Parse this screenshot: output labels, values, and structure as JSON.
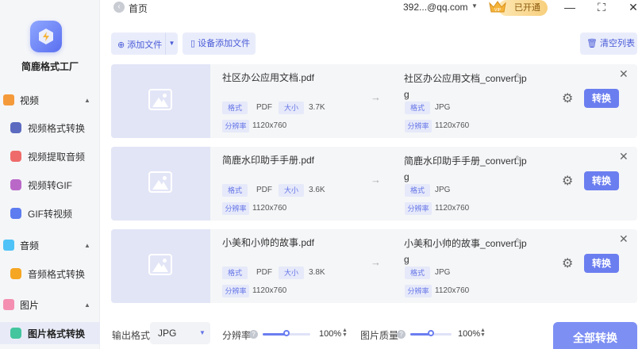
{
  "app": {
    "name": "简鹿格式工厂"
  },
  "sidebar": {
    "categories": [
      {
        "label": "视频",
        "color": "#f59a3b"
      },
      {
        "label": "音频",
        "color": "#4fc3f7"
      },
      {
        "label": "图片",
        "color": "#f48fb1"
      }
    ],
    "items": [
      {
        "label": "视频格式转换",
        "color": "#5c6bc0"
      },
      {
        "label": "视频提取音频",
        "color": "#ef6b6b"
      },
      {
        "label": "视频转GIF",
        "color": "#ba68c8"
      },
      {
        "label": "GIF转视频",
        "color": "#5c7cf0"
      },
      {
        "label": "音频格式转换",
        "color": "#f5a623"
      },
      {
        "label": "图片格式转换",
        "color": "#43c59e"
      }
    ]
  },
  "header": {
    "home_label": "首页",
    "account": "392...@qq.com",
    "vip_label": "已开通",
    "vip_crown_text": "VIP"
  },
  "toolbar": {
    "add_file": "添加文件",
    "device_add": "设备添加文件",
    "clear_list": "清空列表"
  },
  "file_list": {
    "format_tag": "格式",
    "size_tag": "大小",
    "resolution_tag": "分辨率",
    "convert_label": "转换",
    "items": [
      {
        "src_name": "社区办公应用文档.pdf",
        "src_format": "PDF",
        "size": "3.7K",
        "src_res": "1120x760",
        "dst_name": "社区办公应用文档_convert.jpg",
        "dst_format": "JPG",
        "dst_res": "1120x760"
      },
      {
        "src_name": "简鹿水印助手手册.pdf",
        "src_format": "PDF",
        "size": "3.6K",
        "src_res": "1120x760",
        "dst_name": "简鹿水印助手手册_convert.jpg",
        "dst_format": "JPG",
        "dst_res": "1120x760"
      },
      {
        "src_name": "小美和小帅的故事.pdf",
        "src_format": "PDF",
        "size": "3.8K",
        "src_res": "1120x760",
        "dst_name": "小美和小帅的故事_convert.jpg",
        "dst_format": "JPG",
        "dst_res": "1120x760"
      }
    ]
  },
  "bottom": {
    "output_format_label": "输出格式",
    "output_format_value": "JPG",
    "resolution_label": "分辨率",
    "resolution_value": "100%",
    "resolution_level": 1.0,
    "quality_label": "图片质量",
    "quality_value": "100%",
    "quality_level": 1.0,
    "convert_all": "全部转换"
  },
  "colors": {
    "accent": "#6b7ef0",
    "accent_light": "#e9edfb",
    "card_bg": "#f5f6f8",
    "thumb_bg": "#e2e5f6"
  }
}
